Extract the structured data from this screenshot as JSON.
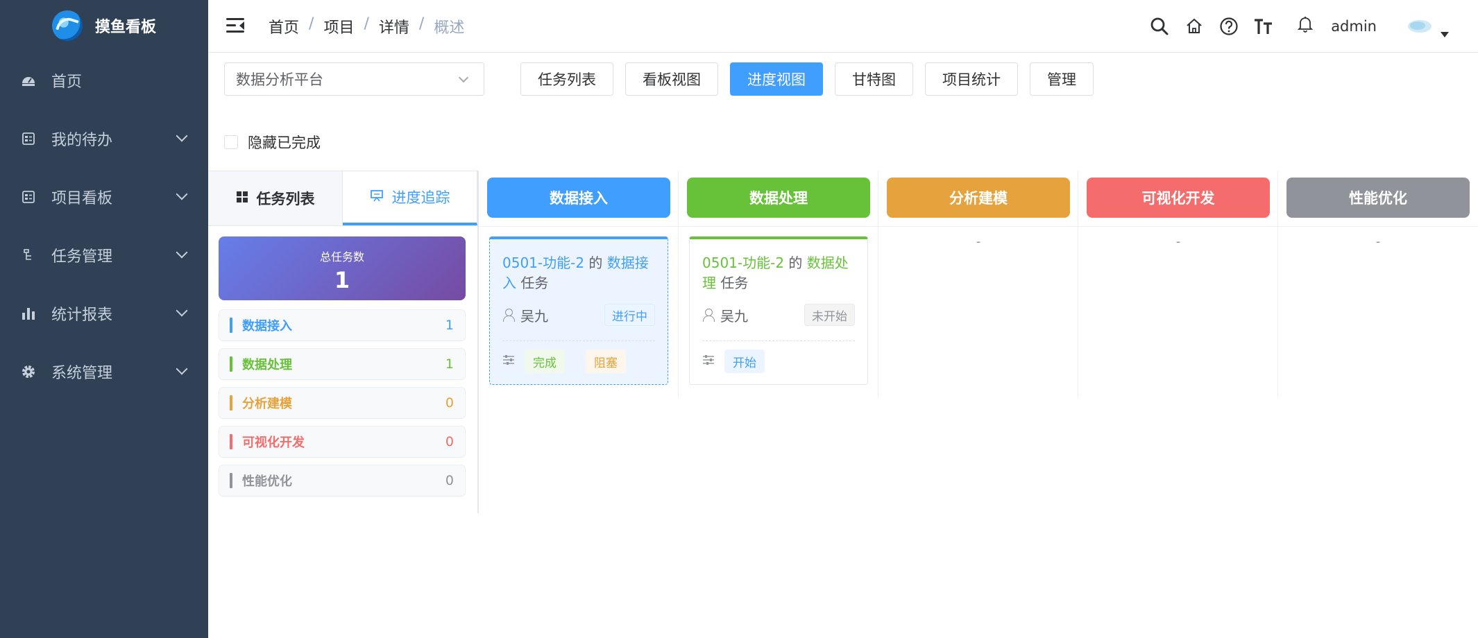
{
  "app": {
    "title": "摸鱼看板"
  },
  "sidebar": {
    "items": [
      {
        "label": "首页",
        "icon": "dashboard-icon",
        "expandable": false
      },
      {
        "label": "我的待办",
        "icon": "todo-icon",
        "expandable": true
      },
      {
        "label": "项目看板",
        "icon": "board-icon",
        "expandable": true
      },
      {
        "label": "任务管理",
        "icon": "tree-icon",
        "expandable": true
      },
      {
        "label": "统计报表",
        "icon": "chart-icon",
        "expandable": true
      },
      {
        "label": "系统管理",
        "icon": "gear-icon",
        "expandable": true
      }
    ]
  },
  "header": {
    "breadcrumb": [
      "首页",
      "项目",
      "详情",
      "概述"
    ],
    "separator": "/",
    "username": "admin"
  },
  "toolbar": {
    "project_select": "数据分析平台",
    "buttons": [
      "任务列表",
      "看板视图",
      "进度视图",
      "甘特图",
      "项目统计",
      "管理"
    ],
    "active_button": "进度视图",
    "hide_completed": "隐藏已完成",
    "hide_completed_checked": false
  },
  "left_panel": {
    "tabs": [
      "任务列表",
      "进度追踪"
    ],
    "active_tab": "进度追踪",
    "total_label": "总任务数",
    "total_value": "1",
    "stages": [
      {
        "name": "数据接入",
        "count": "1",
        "color": "#409eff"
      },
      {
        "name": "数据处理",
        "count": "1",
        "color": "#67c23a"
      },
      {
        "name": "分析建模",
        "count": "0",
        "color": "#e6a23c"
      },
      {
        "name": "可视化开发",
        "count": "0",
        "color": "#f56c6c"
      },
      {
        "name": "性能优化",
        "count": "0",
        "color": "#909399"
      }
    ]
  },
  "board": {
    "columns": [
      {
        "title": "数据接入",
        "color": "#409eff",
        "empty_text": ""
      },
      {
        "title": "数据处理",
        "color": "#67c23a",
        "empty_text": ""
      },
      {
        "title": "分析建模",
        "color": "#e6a23c",
        "empty_text": "-"
      },
      {
        "title": "可视化开发",
        "color": "#f56c6c",
        "empty_text": "-"
      },
      {
        "title": "性能优化",
        "color": "#909399",
        "empty_text": "-"
      }
    ],
    "cards": [
      {
        "task_name": "0501-功能-2",
        "connector": "的",
        "stage": "数据接入",
        "suffix": "任务",
        "assignee": "吴九",
        "status": "进行中",
        "actions": [
          "完成",
          "阻塞"
        ]
      },
      {
        "task_name": "0501-功能-2",
        "connector": "的",
        "stage": "数据处理",
        "suffix": "任务",
        "assignee": "吴九",
        "status": "未开始",
        "actions": [
          "开始"
        ]
      }
    ]
  }
}
